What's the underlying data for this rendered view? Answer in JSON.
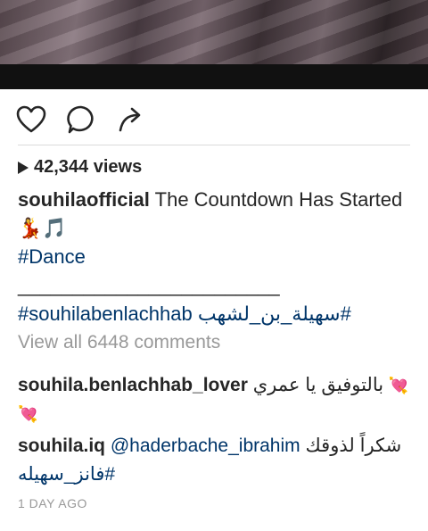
{
  "post": {
    "views_count": "42,344 views",
    "caption": {
      "username": "souhilaofficial",
      "text": "The Countdown Has Started",
      "emoji": "💃🎵",
      "hashtag_line1": "#Dance",
      "separator": "________________________",
      "hashtag_latin": "#souhilabenlachhab",
      "hashtag_arabic": "#سهيلة_بن_لشهب"
    },
    "view_all_comments": "View all 6448 comments",
    "comments": [
      {
        "username": "souhila.benlachhab_lover",
        "text": "بالتوفيق يا عمري",
        "emoji": "💘💘"
      },
      {
        "username": "souhila.iq",
        "mention": "@haderbache_ibrahim",
        "text": "شكراً لذوقك",
        "hashtag": "#فانز_سهيله"
      }
    ],
    "timestamp": "1 DAY AGO"
  },
  "icons": {
    "like": "heart-icon",
    "comment": "comment-bubble-icon",
    "share": "share-arrow-icon",
    "views": "play-icon"
  }
}
